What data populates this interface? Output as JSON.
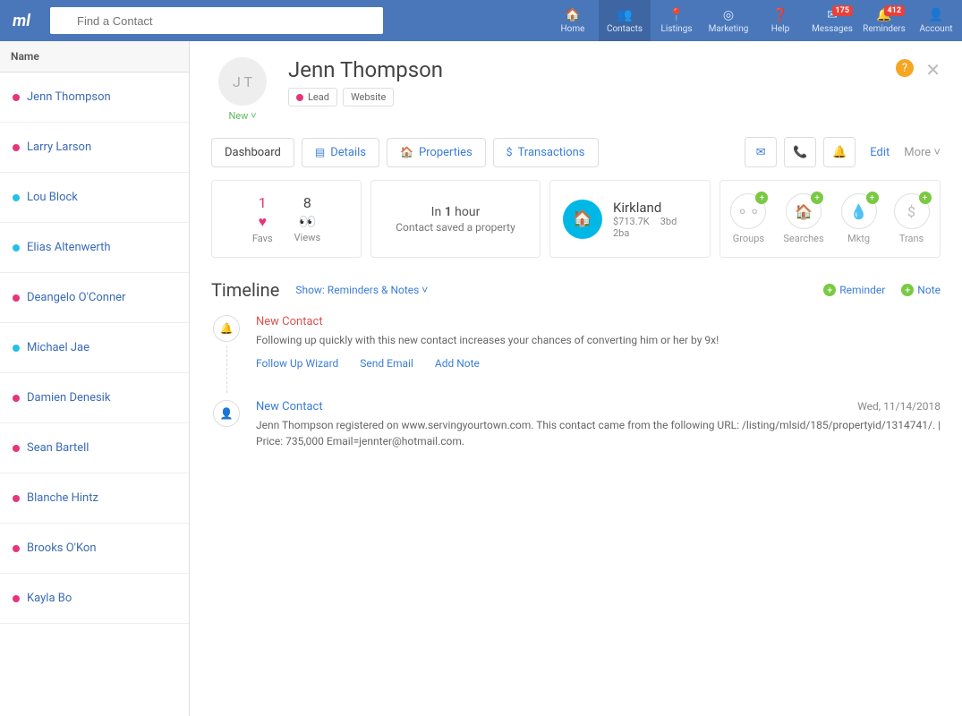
{
  "search": {
    "placeholder": "Find a Contact"
  },
  "nav": {
    "home": "Home",
    "contacts": "Contacts",
    "listings": "Listings",
    "marketing": "Marketing",
    "help": "Help",
    "messages": "Messages",
    "reminders": "Reminders",
    "account": "Account",
    "messages_badge": "175",
    "reminders_badge": "412"
  },
  "sidebar": {
    "header": "Name",
    "items": [
      {
        "name": "Jenn Thompson",
        "color": "pink"
      },
      {
        "name": "Larry Larson",
        "color": "pink"
      },
      {
        "name": "Lou Block",
        "color": "cyan"
      },
      {
        "name": "Elias Altenwerth",
        "color": "cyan"
      },
      {
        "name": "Deangelo O'Conner",
        "color": "pink"
      },
      {
        "name": "Michael Jae",
        "color": "cyan"
      },
      {
        "name": "Damien Denesik",
        "color": "pink"
      },
      {
        "name": "Sean Bartell",
        "color": "pink"
      },
      {
        "name": "Blanche Hintz",
        "color": "pink"
      },
      {
        "name": "Brooks O'Kon",
        "color": "pink"
      },
      {
        "name": "Kayla Bo",
        "color": "pink"
      }
    ]
  },
  "profile": {
    "initials": "J T",
    "name": "Jenn Thompson",
    "new_label": "New ˅",
    "tags": {
      "lead": "Lead",
      "website": "Website"
    }
  },
  "tabs": {
    "dashboard": "Dashboard",
    "details": "Details",
    "properties": "Properties",
    "transactions": "Transactions",
    "edit": "Edit",
    "more": "More ˅"
  },
  "cards": {
    "favs_n": "1",
    "favs_lbl": "Favs",
    "views_n": "8",
    "views_lbl": "Views",
    "c2_l1_pre": "In ",
    "c2_l1_b": "1",
    "c2_l1_post": " hour",
    "c2_l2": "Contact saved a property",
    "loc_name": "Kirkland",
    "loc_price": "$713.7K",
    "loc_bed": "3bd",
    "loc_bath": "2ba",
    "groups": "Groups",
    "searches": "Searches",
    "mktg": "Mktg",
    "trans": "Trans"
  },
  "timeline": {
    "title": "Timeline",
    "show": "Show: Reminders & Notes ˅",
    "add_reminder": "Reminder",
    "add_note": "Note",
    "item1": {
      "title": "New Contact",
      "text": "Following up quickly with this new contact increases your chances of converting him or her by 9x!",
      "a1": "Follow Up Wizard",
      "a2": "Send Email",
      "a3": "Add Note"
    },
    "item2": {
      "title": "New Contact",
      "date": "Wed, 11/14/2018",
      "text": "Jenn Thompson registered on www.servingyourtown.com. This contact came from the following URL: /listing/mlsid/185/propertyid/1314741/. | Price: 735,000 Email=jennter@hotmail.com."
    }
  }
}
